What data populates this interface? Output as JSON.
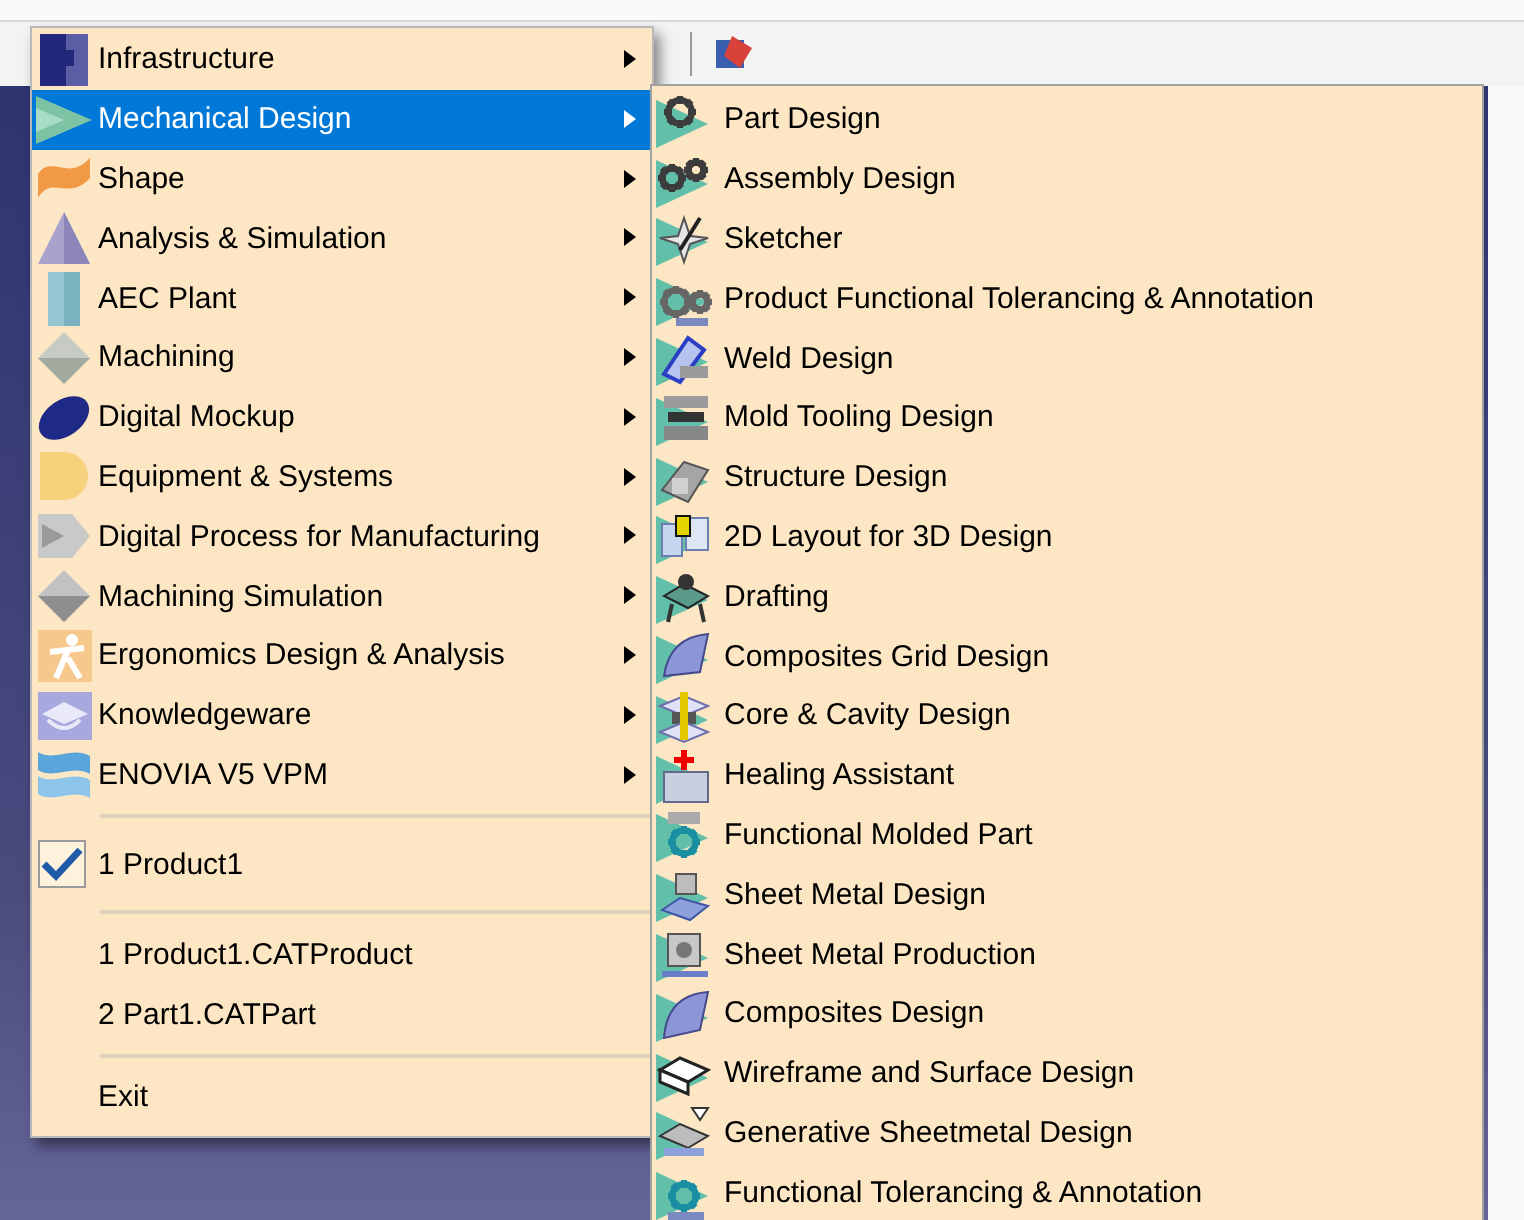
{
  "start_menu": {
    "workbenches": [
      {
        "label": "Infrastructure",
        "has_submenu": true,
        "selected": false
      },
      {
        "label": "Mechanical Design",
        "has_submenu": true,
        "selected": true
      },
      {
        "label": "Shape",
        "has_submenu": true,
        "selected": false
      },
      {
        "label": "Analysis & Simulation",
        "has_submenu": true,
        "selected": false
      },
      {
        "label": "AEC Plant",
        "has_submenu": true,
        "selected": false
      },
      {
        "label": "Machining",
        "has_submenu": true,
        "selected": false
      },
      {
        "label": "Digital Mockup",
        "has_submenu": true,
        "selected": false
      },
      {
        "label": "Equipment & Systems",
        "has_submenu": true,
        "selected": false
      },
      {
        "label": "Digital Process for Manufacturing",
        "has_submenu": true,
        "selected": false
      },
      {
        "label": "Machining Simulation",
        "has_submenu": true,
        "selected": false
      },
      {
        "label": "Ergonomics Design & Analysis",
        "has_submenu": true,
        "selected": false
      },
      {
        "label": "Knowledgeware",
        "has_submenu": true,
        "selected": false
      },
      {
        "label": "ENOVIA V5 VPM",
        "has_submenu": true,
        "selected": false
      }
    ],
    "windows": [
      {
        "label": "1 Product1",
        "checked": true
      }
    ],
    "recent_files": [
      {
        "label": "1 Product1.CATProduct"
      },
      {
        "label": "2 Part1.CATPart"
      }
    ],
    "exit": {
      "label": "Exit"
    }
  },
  "submenu": {
    "items": [
      {
        "label": "Part Design"
      },
      {
        "label": "Assembly Design"
      },
      {
        "label": "Sketcher"
      },
      {
        "label": "Product Functional Tolerancing & Annotation"
      },
      {
        "label": "Weld Design"
      },
      {
        "label": "Mold Tooling Design"
      },
      {
        "label": "Structure Design"
      },
      {
        "label": "2D Layout for 3D Design"
      },
      {
        "label": "Drafting"
      },
      {
        "label": "Composites Grid Design"
      },
      {
        "label": "Core & Cavity Design"
      },
      {
        "label": "Healing Assistant"
      },
      {
        "label": "Functional Molded Part"
      },
      {
        "label": "Sheet Metal Design"
      },
      {
        "label": "Sheet Metal Production"
      },
      {
        "label": "Composites Design"
      },
      {
        "label": "Wireframe and Surface Design"
      },
      {
        "label": "Generative Sheetmetal Design"
      },
      {
        "label": "Functional Tolerancing & Annotation"
      }
    ]
  }
}
